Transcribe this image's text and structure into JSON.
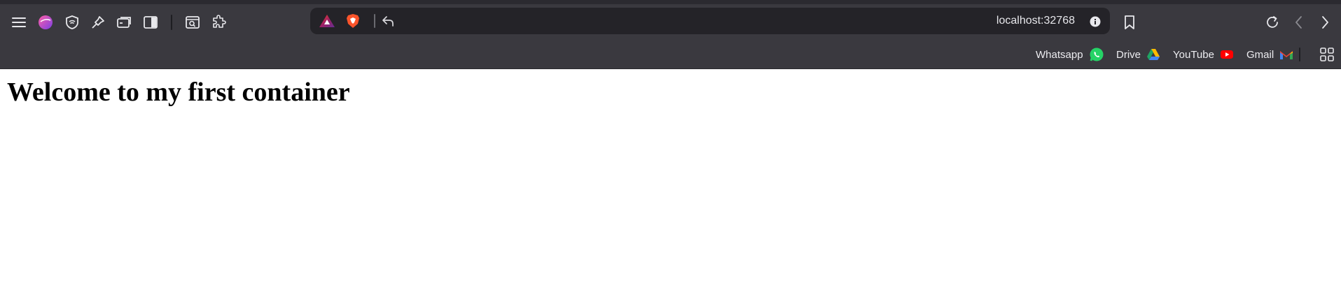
{
  "browser": {
    "toolbar_left_icons": [
      "menu-icon",
      "profile-avatar-icon",
      "shield-icon",
      "pin-icon",
      "tab-icon",
      "sidebar-icon",
      "tab-search-icon",
      "extensions-icon"
    ],
    "url": "localhost:32768",
    "bookmarks": [
      {
        "label": "Whatsapp",
        "icon": "whatsapp-icon",
        "color": "#25D366"
      },
      {
        "label": "Drive",
        "icon": "drive-icon",
        "color": "#1FA463"
      },
      {
        "label": "YouTube",
        "icon": "youtube-icon",
        "color": "#FF0000"
      },
      {
        "label": "Gmail",
        "icon": "gmail-icon",
        "color": "#EA4335"
      }
    ]
  },
  "page": {
    "heading": "Welcome to my first container"
  },
  "colors": {
    "toolbar_bg": "#3a393f",
    "urlbar_bg": "#242328",
    "brave_orange": "#FB542B"
  }
}
